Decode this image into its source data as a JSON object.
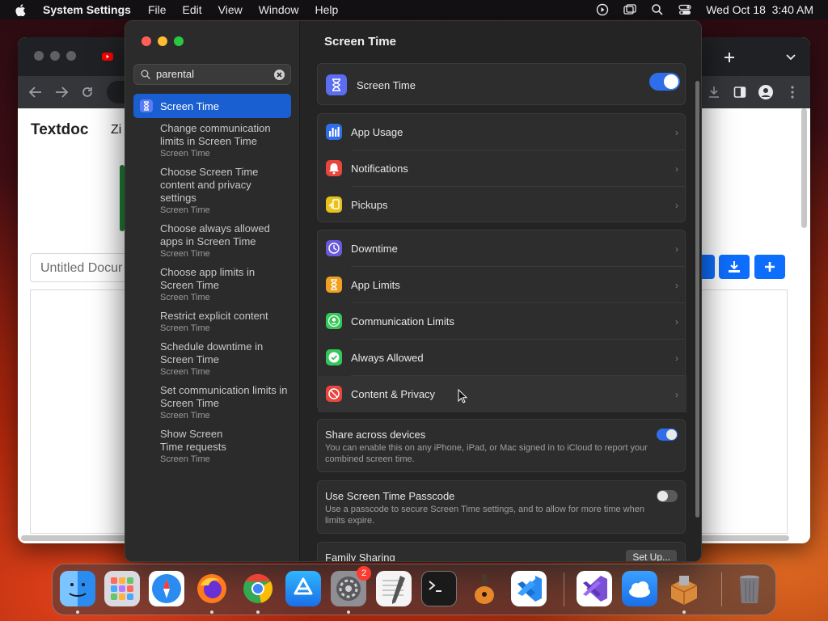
{
  "menubar": {
    "app_name": "System Settings",
    "menus": [
      "File",
      "Edit",
      "View",
      "Window",
      "Help"
    ],
    "datetime": "Wed Oct 18  3:40 AM"
  },
  "browser": {
    "doc_title": "Textdoc",
    "doc_partial": "Zi",
    "doc_name_placeholder": "Untitled Docur"
  },
  "settings": {
    "search": {
      "query": "parental"
    },
    "sidebar_selected": "Screen Time",
    "results": [
      {
        "title": "Change communication limits in Screen Time",
        "section": "Screen Time"
      },
      {
        "title": "Choose Screen Time content and privacy settings",
        "section": "Screen Time"
      },
      {
        "title": "Choose always allowed apps in Screen Time",
        "section": "Screen Time"
      },
      {
        "title": "Choose app limits in Screen Time",
        "section": "Screen Time"
      },
      {
        "title": "Restrict explicit content",
        "section": "Screen Time"
      },
      {
        "title": "Schedule downtime in Screen Time",
        "section": "Screen Time"
      },
      {
        "title": "Set communication limits in Screen Time",
        "section": "Screen Time"
      },
      {
        "title": "Show Screen Time requests",
        "section": "Screen Time"
      }
    ],
    "main": {
      "title": "Screen Time",
      "master_toggle": {
        "label": "Screen Time",
        "on": true
      },
      "group1": [
        {
          "label": "App Usage",
          "icon": "bar-chart-icon",
          "color": "#2f6ee8"
        },
        {
          "label": "Notifications",
          "icon": "bell-icon",
          "color": "#e8453c"
        },
        {
          "label": "Pickups",
          "icon": "pickup-icon",
          "color": "#e8c21a"
        }
      ],
      "group2": [
        {
          "label": "Downtime",
          "icon": "downtime-icon",
          "color": "#6a5ad8"
        },
        {
          "label": "App Limits",
          "icon": "hourglass-icon",
          "color": "#f0a020"
        },
        {
          "label": "Communication Limits",
          "icon": "person-icon",
          "color": "#34c759"
        },
        {
          "label": "Always Allowed",
          "icon": "checkmark-icon",
          "color": "#34c759"
        },
        {
          "label": "Content & Privacy",
          "icon": "block-icon",
          "color": "#e8453c"
        }
      ],
      "share": {
        "title": "Share across devices",
        "desc": "You can enable this on any iPhone, iPad, or Mac signed in to iCloud to report your combined screen time.",
        "on": true
      },
      "passcode": {
        "title": "Use Screen Time Passcode",
        "desc": "Use a passcode to secure Screen Time settings, and to allow for more time when limits expire.",
        "on": false
      },
      "family": {
        "title": "Family Sharing",
        "button": "Set Up..."
      }
    }
  },
  "dock": {
    "apps": [
      "Finder",
      "Launchpad",
      "Safari",
      "Firefox",
      "Chrome",
      "App Store",
      "System Settings",
      "TextEdit",
      "Terminal",
      "GarageBand",
      "VS Code",
      "Visual Studio",
      "Cloud",
      "Archive Utility",
      "Trash"
    ],
    "settings_badge": "2"
  }
}
